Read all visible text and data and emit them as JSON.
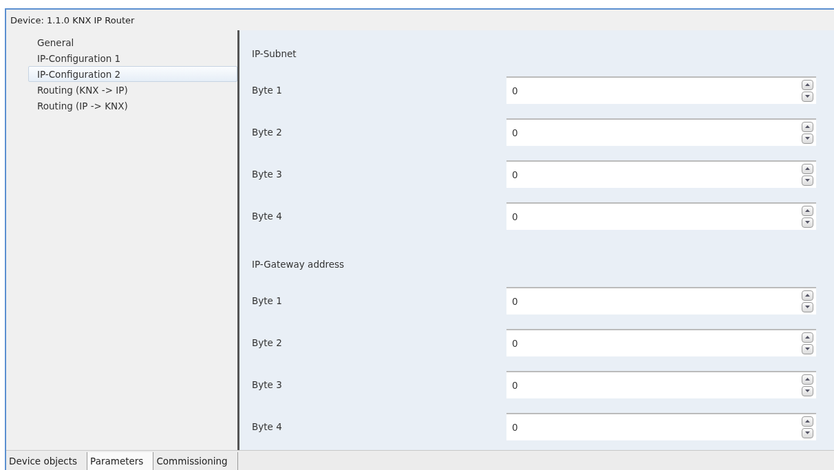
{
  "window": {
    "title": "Device: 1.1.0  KNX IP Router"
  },
  "sidebar": {
    "items": [
      {
        "label": "General",
        "selected": false
      },
      {
        "label": "IP-Configuration 1",
        "selected": false
      },
      {
        "label": "IP-Configuration 2",
        "selected": true
      },
      {
        "label": "Routing (KNX -> IP)",
        "selected": false
      },
      {
        "label": "Routing (IP -> KNX)",
        "selected": false
      }
    ]
  },
  "sections": [
    {
      "title": "IP-Subnet",
      "fields": [
        {
          "label": "Byte 1",
          "value": "0"
        },
        {
          "label": "Byte 2",
          "value": "0"
        },
        {
          "label": "Byte 3",
          "value": "0"
        },
        {
          "label": "Byte 4",
          "value": "0"
        }
      ]
    },
    {
      "title": "IP-Gateway address",
      "fields": [
        {
          "label": "Byte 1",
          "value": "0"
        },
        {
          "label": "Byte 2",
          "value": "0"
        },
        {
          "label": "Byte 3",
          "value": "0"
        },
        {
          "label": "Byte 4",
          "value": "0"
        }
      ]
    }
  ],
  "tabs": [
    {
      "label": "Device objects",
      "selected": false
    },
    {
      "label": "Parameters",
      "selected": true
    },
    {
      "label": "Commissioning",
      "selected": false
    }
  ]
}
